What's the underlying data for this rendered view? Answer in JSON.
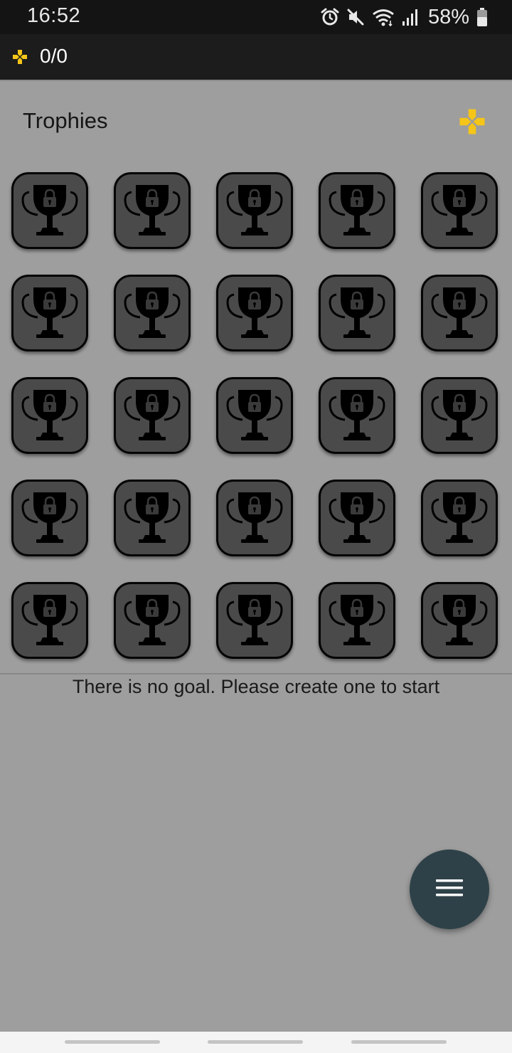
{
  "status_bar": {
    "time": "16:52",
    "battery_percent": "58%",
    "icons": [
      "alarm-icon",
      "mute-icon",
      "wifi-icon",
      "signal-icon",
      "battery-icon"
    ]
  },
  "app_bar": {
    "score": "0/0",
    "icon": "gamepad-icon",
    "accent_color": "#f5c518"
  },
  "trophies": {
    "title": "Trophies",
    "header_icon": "gamepad-icon",
    "rows": 5,
    "columns": 5,
    "items": [
      {
        "state": "locked"
      },
      {
        "state": "locked"
      },
      {
        "state": "locked"
      },
      {
        "state": "locked"
      },
      {
        "state": "locked"
      },
      {
        "state": "locked"
      },
      {
        "state": "locked"
      },
      {
        "state": "locked"
      },
      {
        "state": "locked"
      },
      {
        "state": "locked"
      },
      {
        "state": "locked"
      },
      {
        "state": "locked"
      },
      {
        "state": "locked"
      },
      {
        "state": "locked"
      },
      {
        "state": "locked"
      },
      {
        "state": "locked"
      },
      {
        "state": "locked"
      },
      {
        "state": "locked"
      },
      {
        "state": "locked"
      },
      {
        "state": "locked"
      },
      {
        "state": "locked"
      },
      {
        "state": "locked"
      },
      {
        "state": "locked"
      },
      {
        "state": "locked"
      },
      {
        "state": "locked"
      }
    ]
  },
  "goals": {
    "empty_message": "There is no goal. Please create one to start"
  },
  "fab": {
    "icon": "menu-icon",
    "color": "#2f4148"
  }
}
